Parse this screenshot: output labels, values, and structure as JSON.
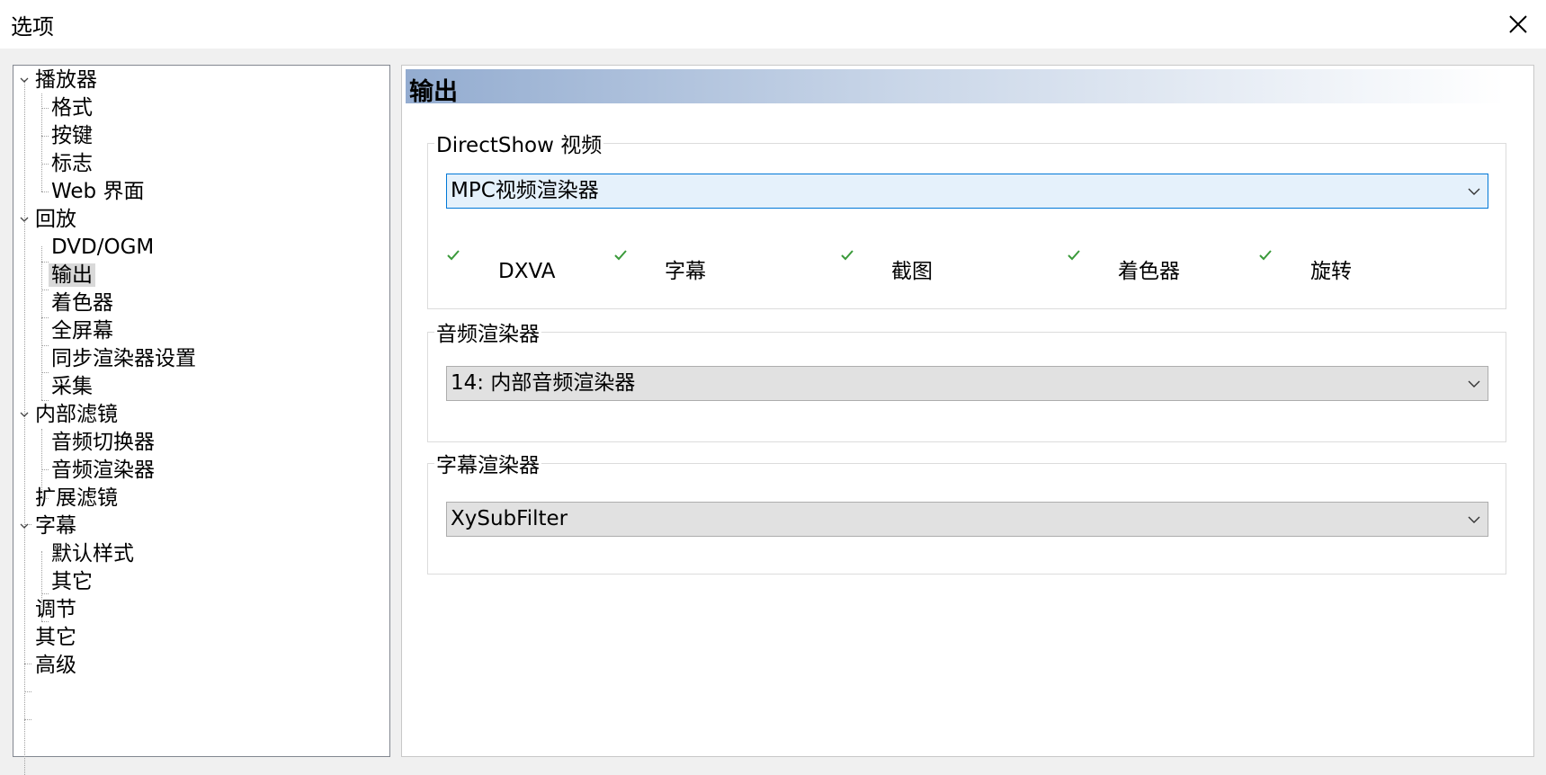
{
  "window": {
    "title": "选项"
  },
  "tree": [
    {
      "label": "播放器",
      "level": 0,
      "expandable": true
    },
    {
      "label": "格式",
      "level": 1
    },
    {
      "label": "按键",
      "level": 1
    },
    {
      "label": "标志",
      "level": 1
    },
    {
      "label": "Web 界面",
      "level": 1
    },
    {
      "label": "回放",
      "level": 0,
      "expandable": true
    },
    {
      "label": "DVD/OGM",
      "level": 1
    },
    {
      "label": "输出",
      "level": 1,
      "selected": true
    },
    {
      "label": "着色器",
      "level": 1
    },
    {
      "label": "全屏幕",
      "level": 1
    },
    {
      "label": "同步渲染器设置",
      "level": 1
    },
    {
      "label": "采集",
      "level": 1
    },
    {
      "label": "内部滤镜",
      "level": 0,
      "expandable": true
    },
    {
      "label": "音频切换器",
      "level": 1
    },
    {
      "label": "音频渲染器",
      "level": 1
    },
    {
      "label": "扩展滤镜",
      "level": 0
    },
    {
      "label": "字幕",
      "level": 0,
      "expandable": true
    },
    {
      "label": "默认样式",
      "level": 1
    },
    {
      "label": "其它",
      "level": 1
    },
    {
      "label": "调节",
      "level": 0
    },
    {
      "label": "其它",
      "level": 0
    },
    {
      "label": "高级",
      "level": 0
    }
  ],
  "page": {
    "header": "输出",
    "directshow": {
      "legend": "DirectShow 视频",
      "renderer": "MPC视频渲染器",
      "capabilities": [
        "DXVA",
        "字幕",
        "截图",
        "着色器",
        "旋转"
      ]
    },
    "audio": {
      "legend": "音频渲染器",
      "renderer": "14: 内部音频渲染器"
    },
    "subtitle": {
      "legend": "字幕渲染器",
      "renderer": "XySubFilter"
    }
  },
  "colors": {
    "check": "#3a9a3a",
    "header_gradient_start": "#93acd0",
    "selection": "#d9d9d9",
    "focus_border": "#0078d7"
  }
}
